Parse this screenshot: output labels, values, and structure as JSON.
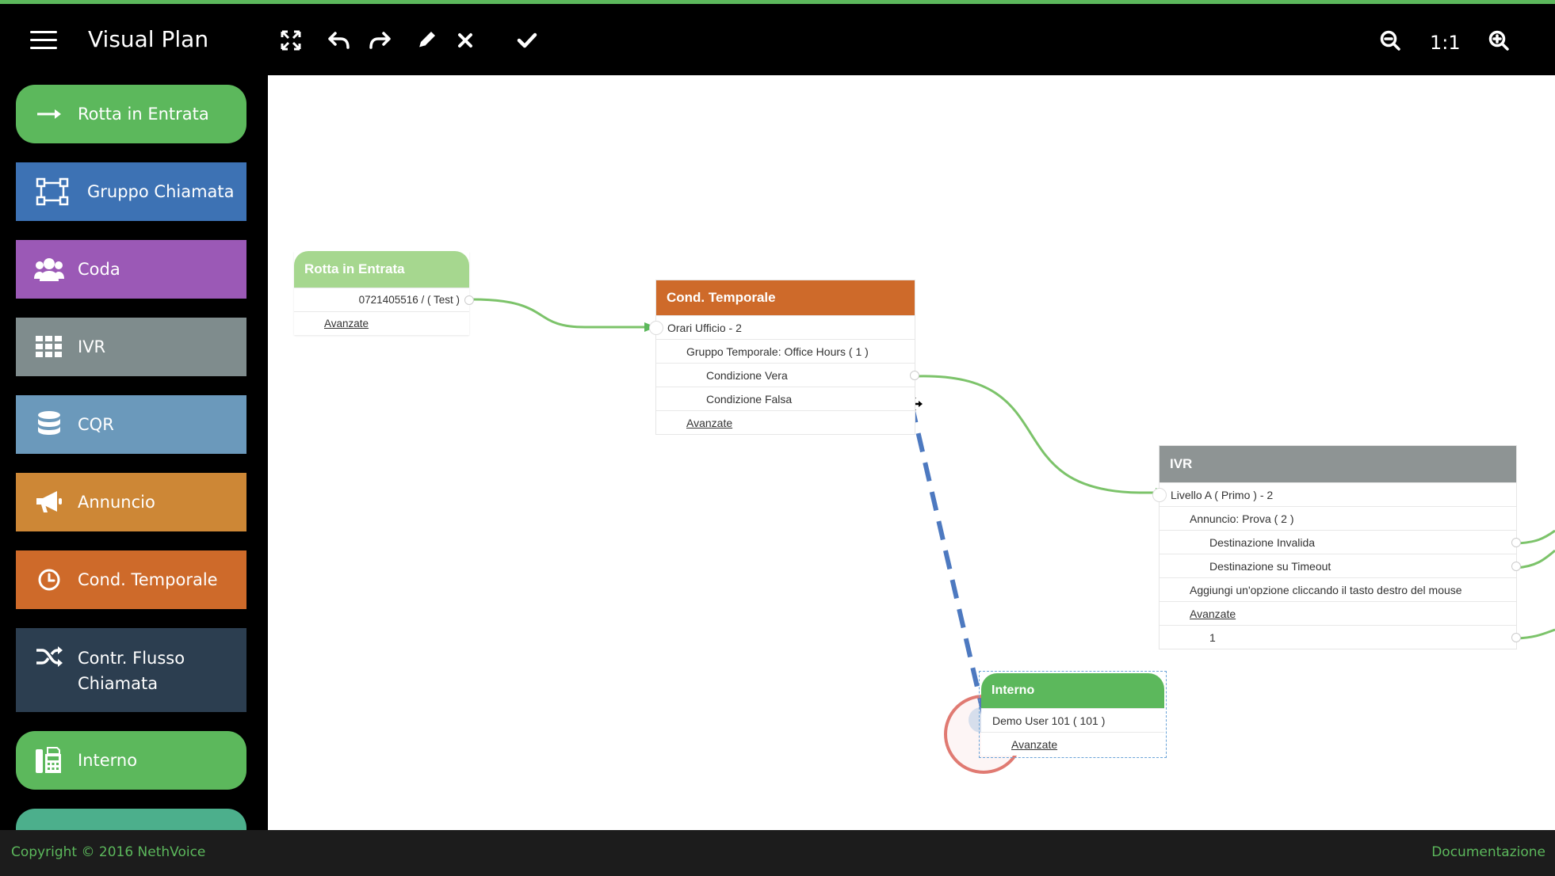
{
  "app": {
    "title": "Visual Plan"
  },
  "toolbar": {
    "icons": [
      "fullscreen-icon",
      "undo-icon",
      "redo-icon",
      "pencil-icon",
      "close-icon",
      "check-icon",
      "zoom-out-icon",
      "zoom-in-icon"
    ],
    "zoom_label": "1:1"
  },
  "sidebar": {
    "items": [
      {
        "label": "Rotta in Entrata",
        "icon": "arrow-right-icon",
        "color": "#5cb85c"
      },
      {
        "label": "Gruppo Chiamata",
        "icon": "group-icon",
        "color": "#3d72b4"
      },
      {
        "label": "Coda",
        "icon": "users-icon",
        "color": "#9b59b6"
      },
      {
        "label": "IVR",
        "icon": "grid-icon",
        "color": "#7f8c8d"
      },
      {
        "label": "CQR",
        "icon": "database-icon",
        "color": "#6b99bb"
      },
      {
        "label": "Annuncio",
        "icon": "bullhorn-icon",
        "color": "#cd8736"
      },
      {
        "label": "Cond. Temporale",
        "icon": "clock-icon",
        "color": "#ce6a2a"
      },
      {
        "label": "Contr. Flusso",
        "label2": "Chiamata",
        "icon": "shuffle-icon",
        "color": "#2c3e50"
      },
      {
        "label": "Interno",
        "icon": "fax-icon",
        "color": "#5cb85c"
      }
    ]
  },
  "nodes": {
    "rotta": {
      "title": "Rotta in Entrata",
      "number": "0721405516 / ( Test )",
      "advanced": "Avanzate",
      "color": "#a6d78f"
    },
    "cond": {
      "title": "Cond. Temporale",
      "row1": "Orari Ufficio - 2",
      "row2": "Gruppo Temporale: Office Hours ( 1 )",
      "row3": "Condizione Vera",
      "row4": "Condizione Falsa",
      "advanced": "Avanzate",
      "color": "#ce6a2a"
    },
    "ivr": {
      "title": "IVR",
      "row1": "Livello A ( Primo ) - 2",
      "row2": "Annuncio: Prova ( 2 )",
      "row3": "Destinazione Invalida",
      "row4": "Destinazione su Timeout",
      "row5": "Aggiungi un'opzione cliccando il tasto destro del mouse",
      "advanced": "Avanzate",
      "row7": "1",
      "color": "#8e9494"
    },
    "interno": {
      "title": "Interno",
      "row1": "Demo User 101 ( 101 )",
      "advanced": "Avanzate",
      "color": "#5cb85c"
    }
  },
  "footer": {
    "copyright": "Copyright © 2016 NethVoice",
    "docs": "Documentazione"
  }
}
